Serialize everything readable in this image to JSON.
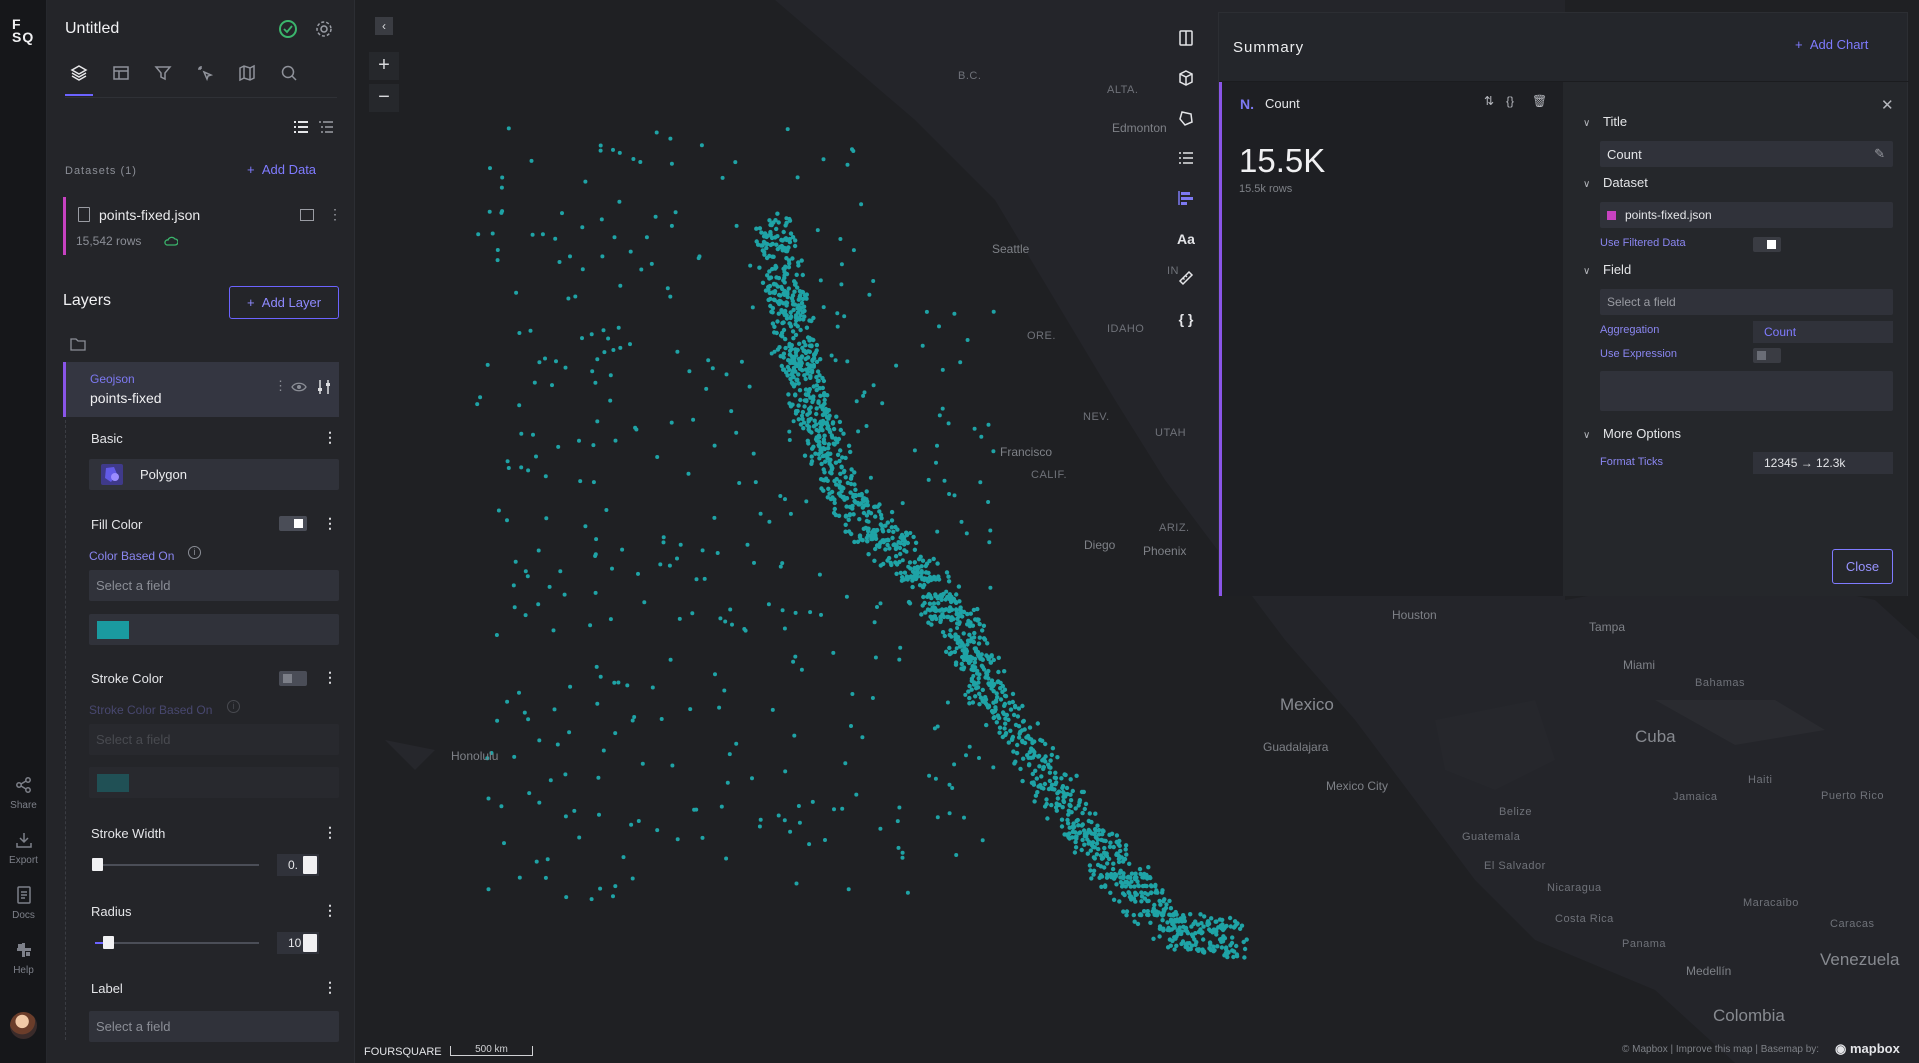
{
  "app": {
    "logo_line1": "F",
    "logo_line2": "SQ",
    "title": "Untitled"
  },
  "rail": [
    {
      "icon": "share-icon",
      "label": "Share"
    },
    {
      "icon": "export-icon",
      "label": "Export"
    },
    {
      "icon": "docs-icon",
      "label": "Docs"
    },
    {
      "icon": "help-icon",
      "label": "Help"
    }
  ],
  "tabs": [
    "layers-icon",
    "table-icon",
    "filter-icon",
    "interactions-icon",
    "basemap-icon",
    "search-icon"
  ],
  "datasets": {
    "label": "Datasets (1)",
    "add_label": "Add Data",
    "items": [
      {
        "name": "points-fixed.json",
        "rows": "15,542 rows",
        "color": "#c742c1"
      }
    ]
  },
  "layers": {
    "title": "Layers",
    "add_label": "Add Layer",
    "card": {
      "type": "Geojson",
      "name": "points-fixed"
    },
    "basic": {
      "label": "Basic",
      "type": "Polygon"
    },
    "fill": {
      "label": "Fill Color",
      "based_on": "Color Based On",
      "placeholder": "Select a field",
      "color": "#1a9aa0"
    },
    "stroke": {
      "label": "Stroke Color",
      "based_on": "Stroke Color Based On",
      "placeholder": "Select a field",
      "color": "#1a5a60"
    },
    "stroke_width": {
      "label": "Stroke Width",
      "value": "0.",
      "fraction": 0.0
    },
    "radius": {
      "label": "Radius",
      "value": "10",
      "fraction": 0.05
    },
    "label": {
      "label": "Label",
      "placeholder": "Select a field"
    }
  },
  "map": {
    "zoom_in": "+",
    "zoom_out": "−",
    "collapse": "‹",
    "point_color": "#1fa3a6",
    "labels": {
      "bc": "B.C.",
      "alta": "ALTA.",
      "edmonton": "Edmonton",
      "seattle": "Seattle",
      "ore": "ORE.",
      "idaho": "IDAHO",
      "nev": "NEV.",
      "utah": "UTAH",
      "sf": "Francisco",
      "calif": "CALIF.",
      "diego": "Diego",
      "ariz": "ARIZ.",
      "phoenix": "Phoenix",
      "houston": "Houston",
      "tampa": "Tampa",
      "miami": "Miami",
      "bahamas": "Bahamas",
      "mexico": "Mexico",
      "cuba": "Cuba",
      "guadalajara": "Guadalajara",
      "mexico_city": "Mexico City",
      "honolulu": "Honolulu",
      "haiti": "Haiti",
      "jamaica": "Jamaica",
      "puerto_rico": "Puerto Rico",
      "belize": "Belize",
      "guatemala": "Guatemala",
      "el_salvador": "El Salvador",
      "nicaragua": "Nicaragua",
      "costa_rica": "Costa Rica",
      "panama": "Panama",
      "maracaibo": "Maracaibo",
      "caracas": "Caracas",
      "venezuela": "Venezuela",
      "medellin": "Medellín",
      "colombia": "Colombia",
      "in": "IN"
    },
    "fsq": "FOURSQUARE",
    "scale": "500 km",
    "attribution": "© Mapbox | Improve this map | Basemap by:",
    "mapbox": "mapbox"
  },
  "summary": {
    "title": "Summary",
    "add_chart": "Add Chart",
    "card": {
      "icon": "N.",
      "name": "Count",
      "value": "15.5K",
      "rows": "15.5k rows"
    },
    "config": {
      "title_label": "Title",
      "title_value": "Count",
      "dataset_label": "Dataset",
      "dataset_value": "points-fixed.json",
      "use_filtered": "Use Filtered Data",
      "field_label": "Field",
      "field_placeholder": "Select a field",
      "aggregation_label": "Aggregation",
      "aggregation_value": "Count",
      "use_expression": "Use Expression",
      "more_options": "More Options",
      "format_ticks_label": "Format Ticks",
      "format_ticks_value": "12345 → 12.3k",
      "close": "Close"
    }
  }
}
